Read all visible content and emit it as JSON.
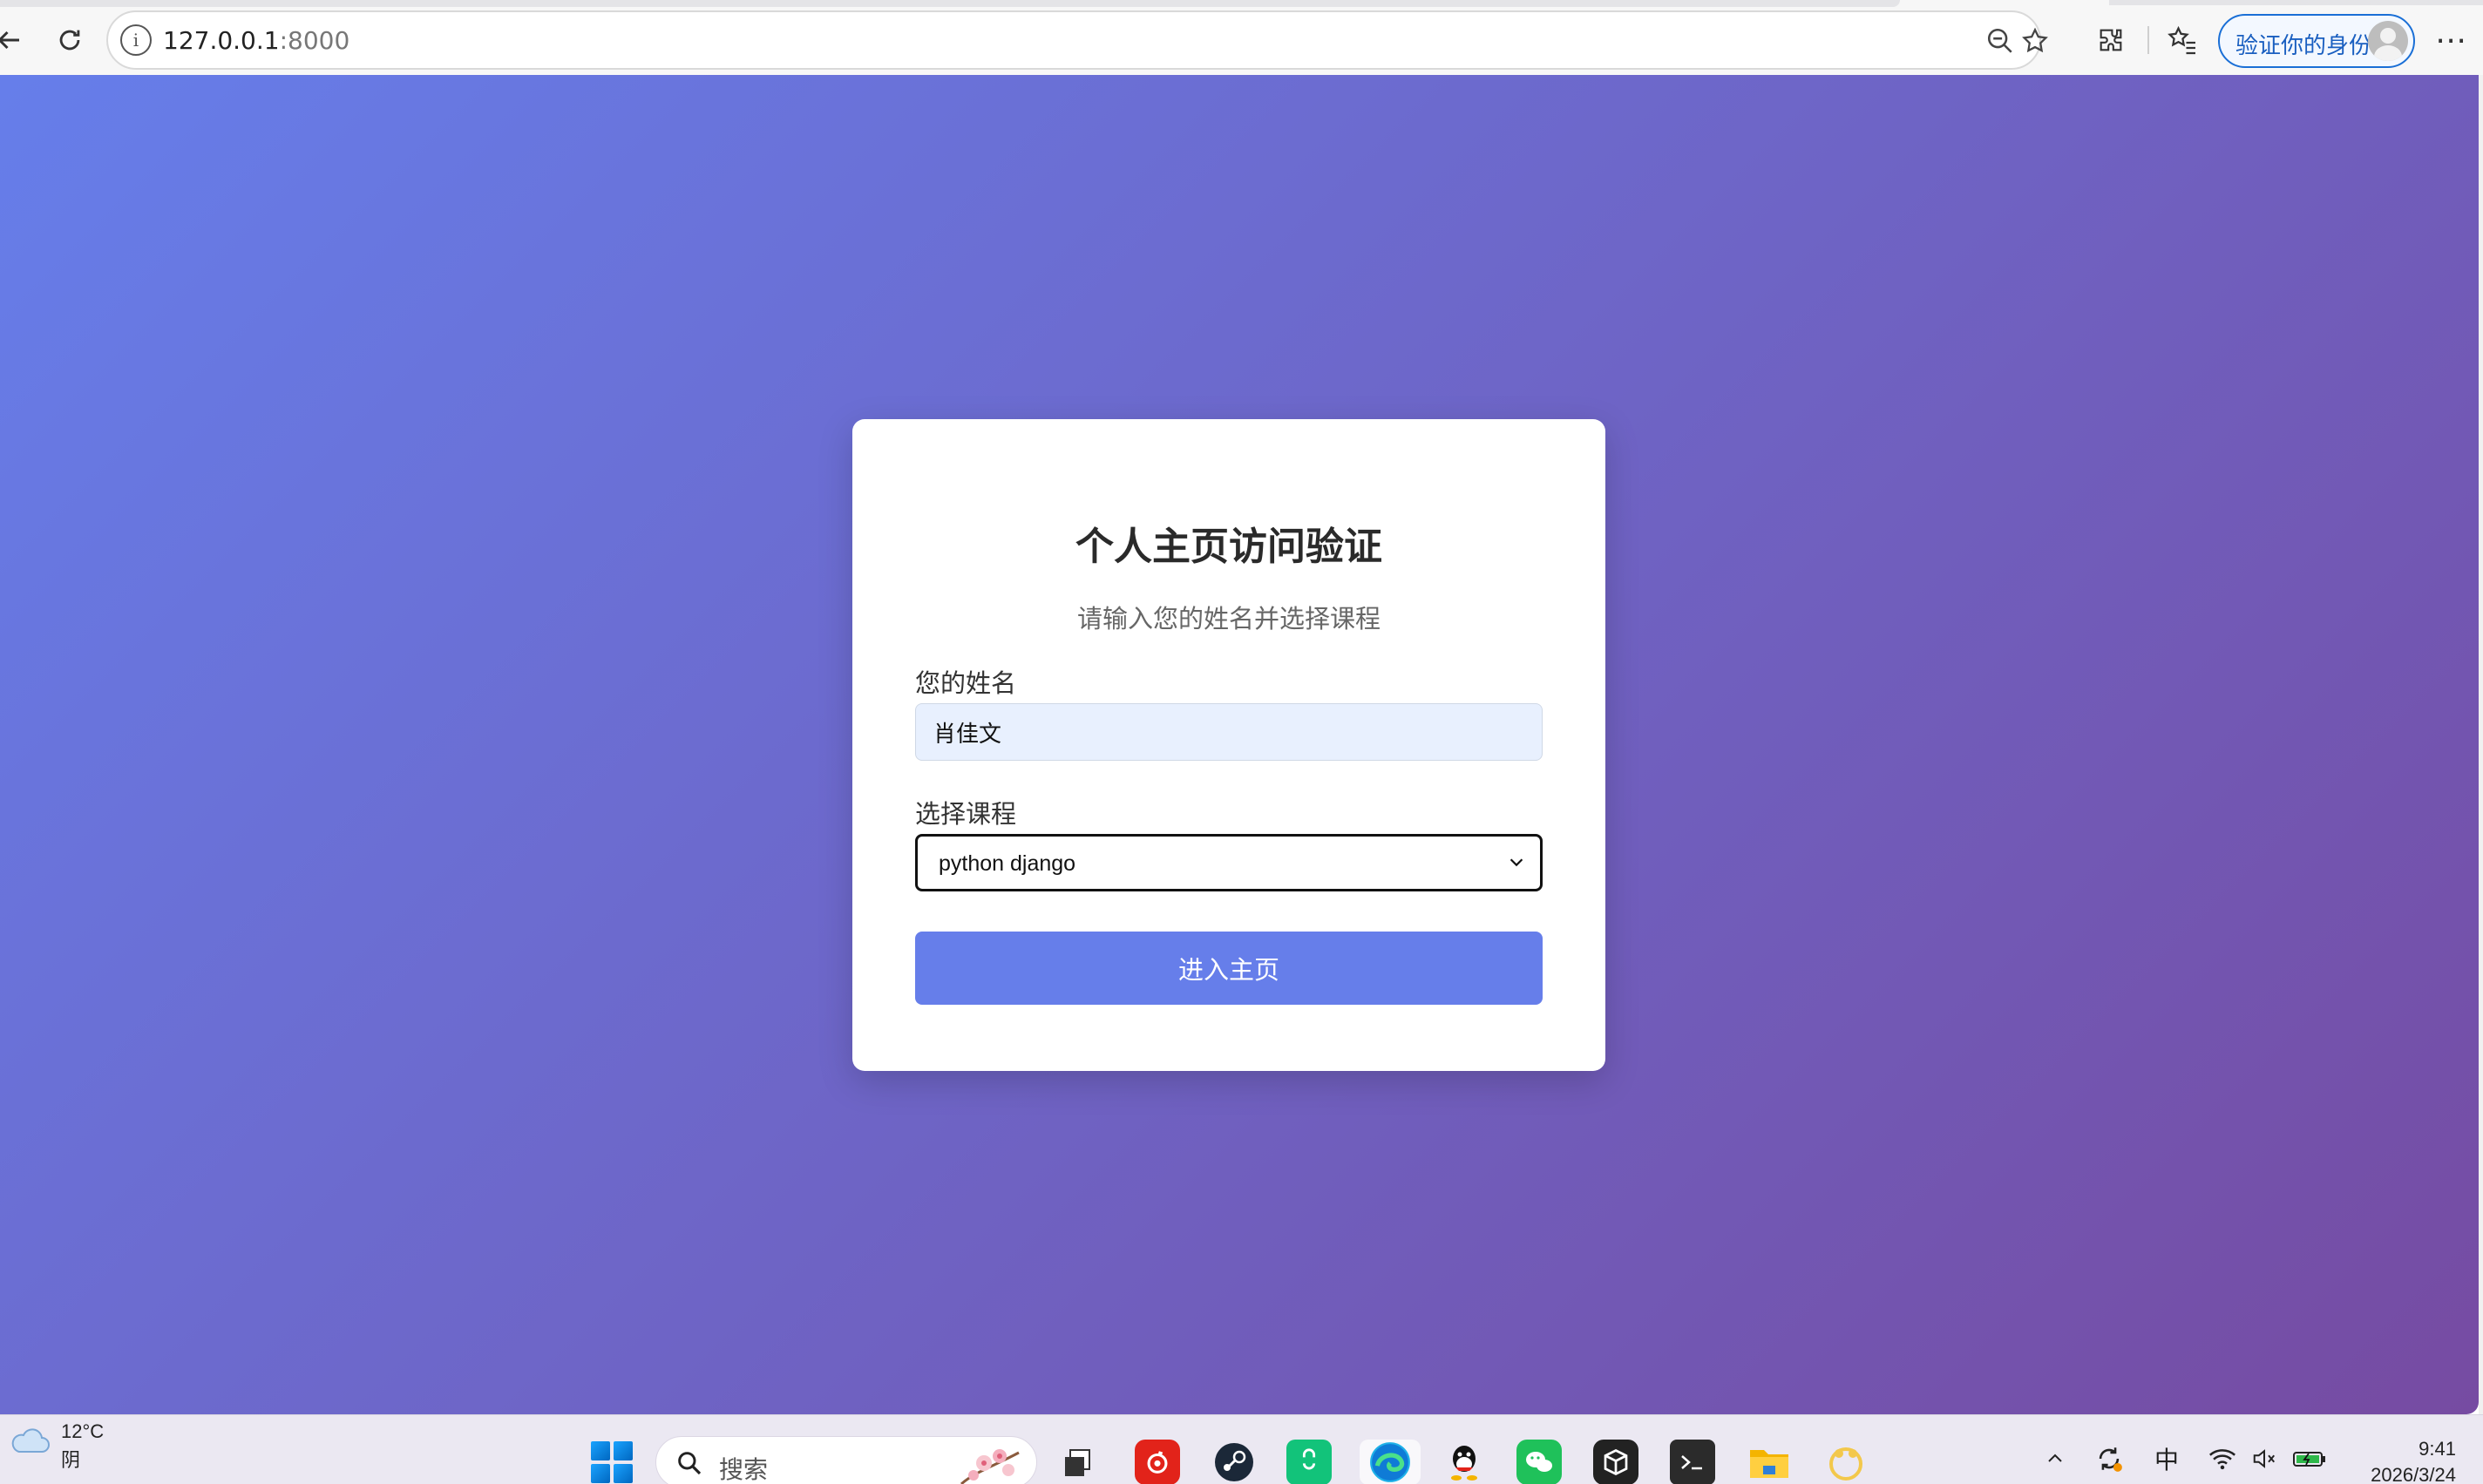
{
  "browser": {
    "url_host": "127.0.0.1",
    "url_port": ":8000",
    "profile_label": "验证你的身份",
    "icons": [
      "back-icon",
      "refresh-icon",
      "info-icon",
      "zoom-out-icon",
      "favorite-star-icon",
      "extensions-icon",
      "favorites-icon",
      "avatar",
      "more-icon"
    ]
  },
  "page": {
    "title": "个人主页访问验证",
    "subtitle": "请输入您的姓名并选择课程",
    "name_label": "您的姓名",
    "name_value": "肖佳文",
    "course_label": "选择课程",
    "course_value": "python django",
    "submit_label": "进入主页",
    "colors": {
      "gradient_start": "#667eea",
      "gradient_end": "#764ba2",
      "button": "#667eea",
      "input_fill": "#e8f0fe"
    }
  },
  "taskbar": {
    "weather_temp": "12°C",
    "weather_desc": "阴",
    "search_placeholder": "搜索",
    "apps": [
      "start-icon",
      "task-view-icon",
      "netease-music-icon",
      "steam-icon",
      "store-bag-icon",
      "edge-icon",
      "qq-icon",
      "wechat-icon",
      "box-app-icon",
      "terminal-icon",
      "file-explorer-icon",
      "paw-app-icon"
    ],
    "tray": {
      "ime": "中",
      "time": "9:41",
      "date": "2026/3/24"
    }
  }
}
